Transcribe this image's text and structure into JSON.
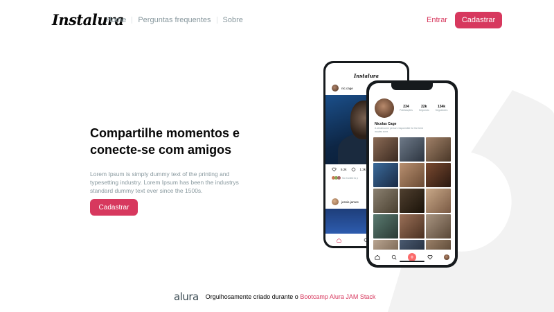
{
  "header": {
    "logo": "Instalura",
    "nav": [
      "Home",
      "Perguntas frequentes",
      "Sobre"
    ],
    "login_label": "Entrar",
    "signup_label": "Cadastrar"
  },
  "hero": {
    "title": "Compartilhe momentos e conecte-se com amigos",
    "text": "Lorem Ipsum is simply dummy text of the printing and typesetting industry. Lorem Ipsum has been the industrys standard dummy text ever since the 1500s.",
    "cta_label": "Cadastrar"
  },
  "phone_back": {
    "logo": "Instalura",
    "post_user": "nic.cage",
    "likes": "5.2k",
    "comments": "1.2k",
    "liked_by": "So excited to p",
    "post_user2": "jessie.james"
  },
  "phone_front": {
    "stats": [
      {
        "value": "234",
        "label": "Publicações"
      },
      {
        "value": "22k",
        "label": "Seguindo"
      },
      {
        "value": "134k",
        "label": "Seguidores"
      }
    ],
    "name": "Nicolas Cage",
    "bio": "A wholesome person responsible for the best movies ever."
  },
  "footer": {
    "logo": "alura",
    "text": "Orgulhosamente criado durante o",
    "link": "Bootcamp Alura JAM Stack"
  },
  "colors": {
    "primary": "#d7385e",
    "text": "#070707",
    "muted": "#88989e",
    "bg_shape": "#f2f2f2"
  }
}
